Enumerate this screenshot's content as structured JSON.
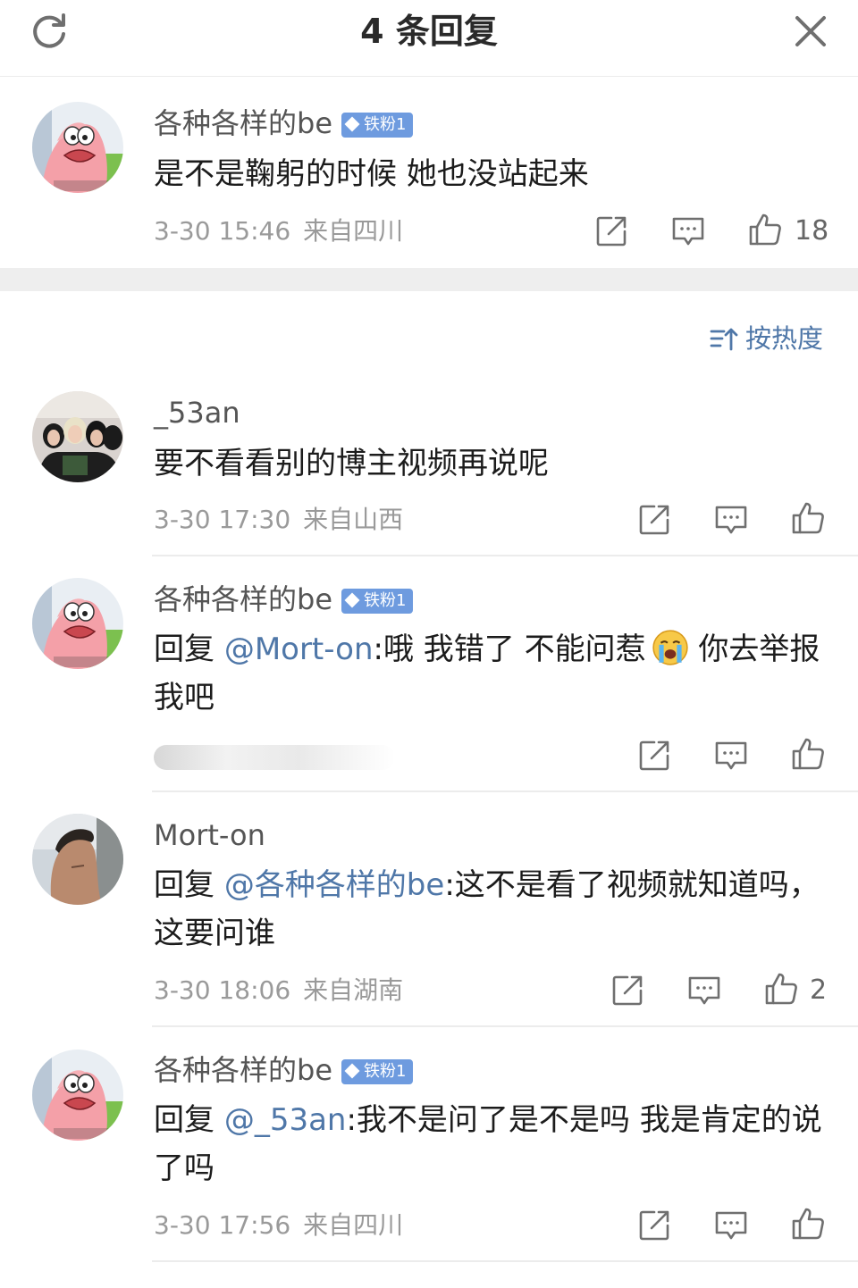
{
  "header": {
    "title": "4 条回复"
  },
  "main_comment": {
    "username": "各种各样的be",
    "badge": "铁粉1",
    "text": "是不是鞠躬的时候 她也没站起来",
    "time": "3-30 15:46",
    "location": "来自四川",
    "likes": "18"
  },
  "sort": {
    "label": "按热度"
  },
  "replies": [
    {
      "username": "_53an",
      "text": "要不看看别的博主视频再说呢",
      "time": "3-30 17:30",
      "location": "来自山西"
    },
    {
      "username": "各种各样的be",
      "badge": "铁粉1",
      "reply_prefix": "回复 ",
      "mention": "@Mort-on",
      "text": ":哦 我错了 不能问惹",
      "text_after": " 你去举报我吧"
    },
    {
      "username": "Mort-on",
      "reply_prefix": "回复 ",
      "mention": "@各种各样的be",
      "text": ":这不是看了视频就知道吗，这要问谁",
      "time": "3-30 18:06",
      "location": "来自湖南",
      "likes": "2"
    },
    {
      "username": "各种各样的be",
      "badge": "铁粉1",
      "reply_prefix": "回复 ",
      "mention": "@_53an",
      "text": ":我不是问了是不是吗 我是肯定的说了吗",
      "time": "3-30 17:56",
      "location": "来自四川"
    }
  ],
  "icons": {
    "refresh": "refresh-icon",
    "close": "close-icon",
    "sort": "sort-icon",
    "share": "share-icon",
    "comment": "comment-icon",
    "like": "thumbs-up-icon",
    "emoji": "crying-face-emoji"
  },
  "colors": {
    "accent": "#4f77a8",
    "badge": "#6e9bdf",
    "meta": "#9a9a9a"
  }
}
